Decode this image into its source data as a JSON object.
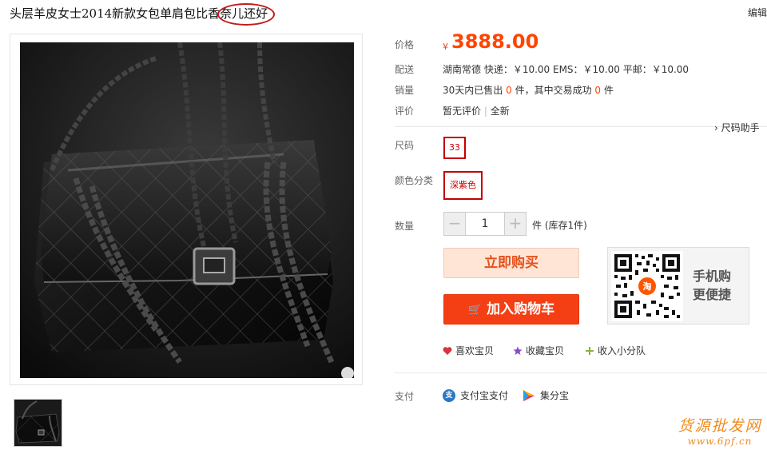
{
  "product": {
    "title": "头层羊皮女士2014新款女包单肩包比香奈儿还好",
    "edit_label": "编辑"
  },
  "labels": {
    "price": "价格",
    "shipping": "配送",
    "sales": "销量",
    "reviews": "评价",
    "size": "尺码",
    "color": "颜色分类",
    "quantity": "数量",
    "payment": "支付"
  },
  "price": {
    "currency_symbol": "¥",
    "amount": "3888.00"
  },
  "shipping": {
    "text": "湖南常德 快递：￥10.00 EMS：￥10.00 平邮：￥10.00"
  },
  "sales": {
    "prefix": "30天内已售出",
    "sold_count": "0",
    "middle": "件，其中交易成功",
    "success_count": "0",
    "suffix": "件"
  },
  "reviews": {
    "text": "暂无评价",
    "divider": "|",
    "condition": "全新"
  },
  "size_helper": "› 尺码助手",
  "options": {
    "size_value": "33",
    "color_value": "深紫色"
  },
  "quantity": {
    "minus": "−",
    "value": "1",
    "plus": "+",
    "stock_text": "件 (库存1件)"
  },
  "buttons": {
    "buy_now": "立即购买",
    "cart_glyph": "🛒",
    "add_to_cart": "加入购物车"
  },
  "mobile": {
    "line1": "手机购",
    "line2": "更便捷",
    "badge": "淘"
  },
  "social": {
    "like": "喜欢宝贝",
    "favorite": "收藏宝贝",
    "squad": "收入小分队"
  },
  "payment_methods": {
    "alipay": "支付宝支付",
    "alipay_glyph": "支",
    "jifenbao": "集分宝"
  },
  "watermark": {
    "cn": "货源批发网",
    "url": "www.6pf.cn"
  },
  "colors": {
    "accent": "#ff4400",
    "cart_button": "#f43f15",
    "buy_button_bg": "#ffe5d6",
    "option_border": "#c40000",
    "title_circle": "#c41a1a",
    "watermark": "#f18b1d"
  },
  "icons": {
    "heart": "heart-icon",
    "star": "star-icon",
    "plus": "plus-icon",
    "cart": "cart-icon",
    "alipay": "alipay-icon",
    "jifenbao": "jifenbao-icon",
    "qr": "qr-code-icon"
  }
}
